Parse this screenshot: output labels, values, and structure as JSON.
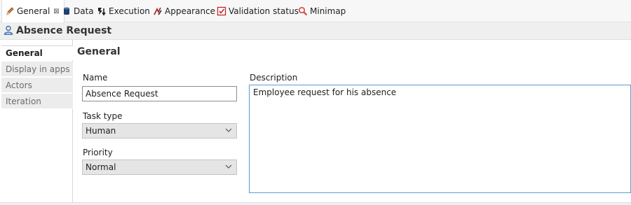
{
  "tabs": [
    {
      "label": "General",
      "icon": "pencil-icon",
      "active": true,
      "close": "⊠"
    },
    {
      "label": "Data",
      "icon": "database-icon"
    },
    {
      "label": "Execution",
      "icon": "execution-icon"
    },
    {
      "label": "Appearance",
      "icon": "brush-icon"
    },
    {
      "label": "Validation status",
      "icon": "check-box-icon"
    },
    {
      "label": "Minimap",
      "icon": "magnifier-icon"
    }
  ],
  "header": {
    "title": "Absence Request",
    "icon": "user-icon"
  },
  "side_tabs": [
    {
      "label": "General",
      "active": true
    },
    {
      "label": "Display in apps"
    },
    {
      "label": "Actors"
    },
    {
      "label": "Iteration"
    }
  ],
  "section": {
    "title": "General"
  },
  "form": {
    "name_label": "Name",
    "name_value": "Absence Request",
    "task_type_label": "Task type",
    "task_type_value": "Human",
    "priority_label": "Priority",
    "priority_value": "Normal",
    "description_label": "Description",
    "description_value": "Employee request for his absence"
  },
  "colors": {
    "focus_border": "#5a9bd5",
    "section_title": "#333333"
  }
}
